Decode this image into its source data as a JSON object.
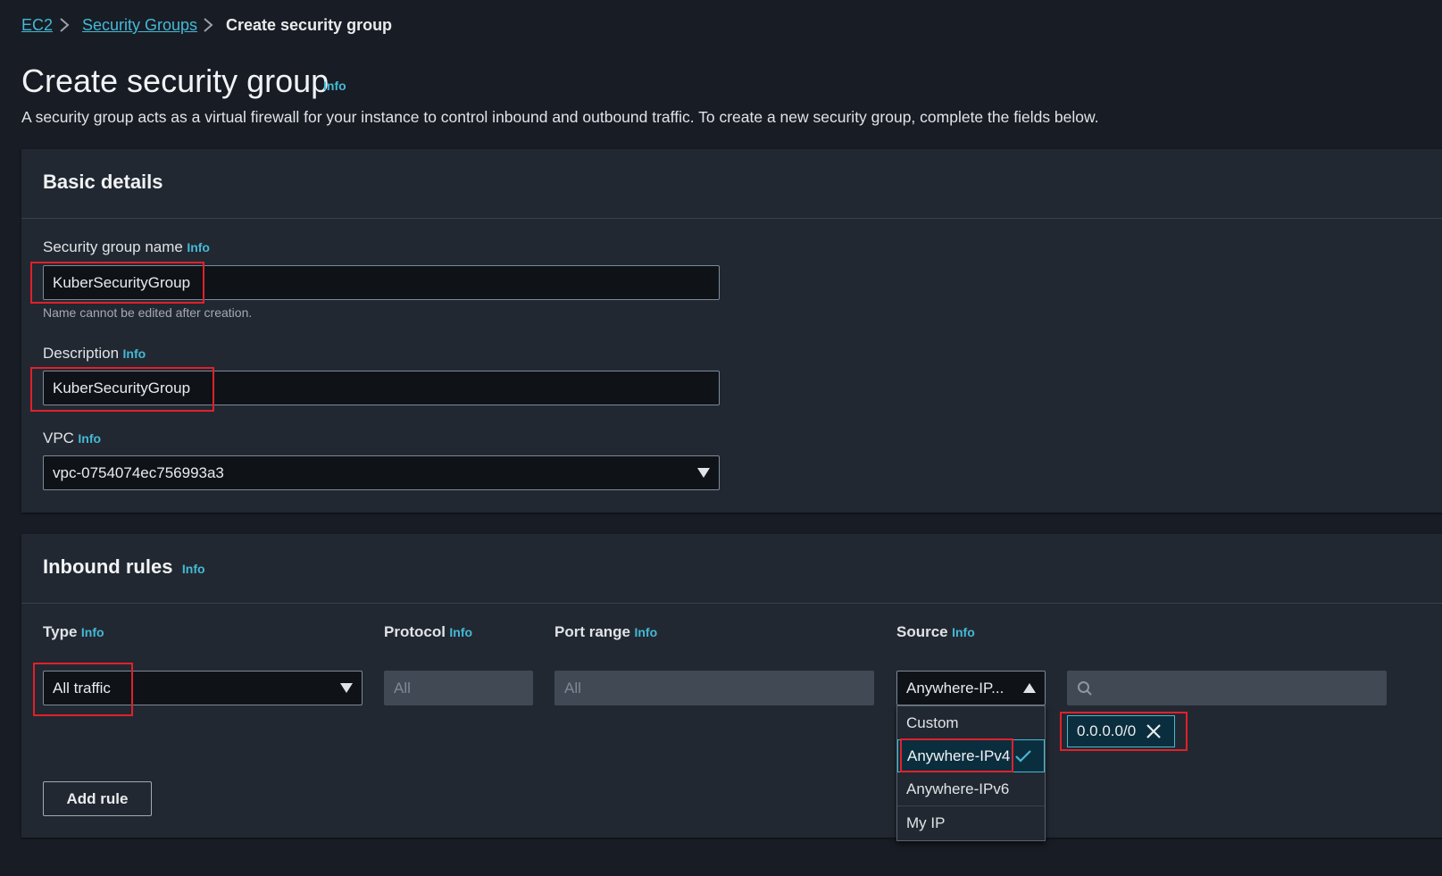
{
  "breadcrumb": {
    "items": [
      "EC2",
      "Security Groups"
    ],
    "current": "Create security group"
  },
  "page": {
    "title": "Create security group",
    "info_label": "Info",
    "description": "A security group acts as a virtual firewall for your instance to control inbound and outbound traffic. To create a new security group, complete the fields below."
  },
  "basic_details": {
    "heading": "Basic details",
    "name_label": "Security group name",
    "name_info": "Info",
    "name_value": "KuberSecurityGroup",
    "name_hint": "Name cannot be edited after creation.",
    "description_label": "Description",
    "description_info": "Info",
    "description_value": "KuberSecurityGroup",
    "vpc_label": "VPC",
    "vpc_info": "Info",
    "vpc_value": "vpc-0754074ec756993a3"
  },
  "inbound": {
    "heading": "Inbound rules",
    "info": "Info",
    "columns": {
      "type": "Type",
      "protocol": "Protocol",
      "port_range": "Port range",
      "source": "Source",
      "info": "Info"
    },
    "rule": {
      "type_value": "All traffic",
      "protocol_value": "All",
      "port_range_value": "All",
      "source_value": "Anywhere-IP...",
      "cidr_token": "0.0.0.0/0"
    },
    "source_options": [
      "Custom",
      "Anywhere-IPv4",
      "Anywhere-IPv6",
      "My IP"
    ],
    "selected_option": "Anywhere-IPv4",
    "add_rule_label": "Add rule"
  },
  "colors": {
    "background": "#181c24",
    "panel": "#222831",
    "link": "#44b9d6",
    "highlight": "#e0212b"
  }
}
